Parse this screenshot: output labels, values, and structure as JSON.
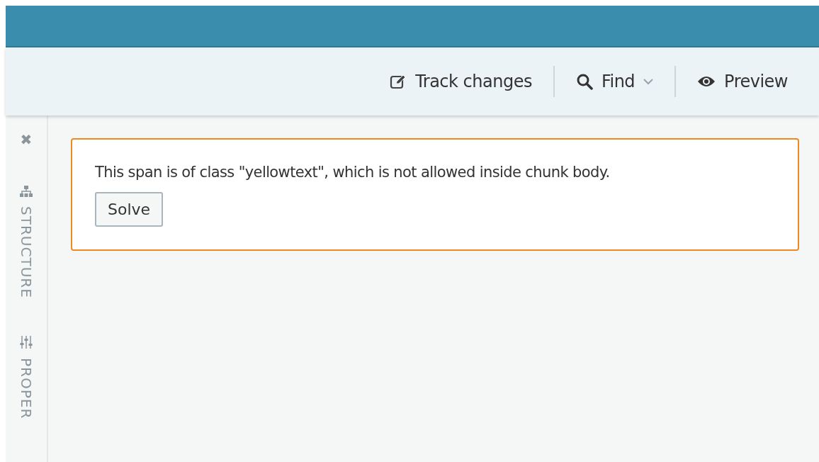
{
  "toolbar": {
    "buttons": [
      {
        "kind": "edit",
        "label": "Track changes"
      },
      {
        "kind": "search",
        "label": "Find",
        "dropdown": true
      },
      {
        "kind": "view",
        "label": "Preview"
      }
    ]
  },
  "sidebar": {
    "close": "✖",
    "tabs": [
      {
        "kind": "structure",
        "label": "STRUCTURE"
      },
      {
        "kind": "properties",
        "label": "PROPER"
      }
    ]
  },
  "issue": {
    "message": "This span is of class \"yellowtext\", which is not allowed inside chunk body.",
    "button": "Solve"
  }
}
